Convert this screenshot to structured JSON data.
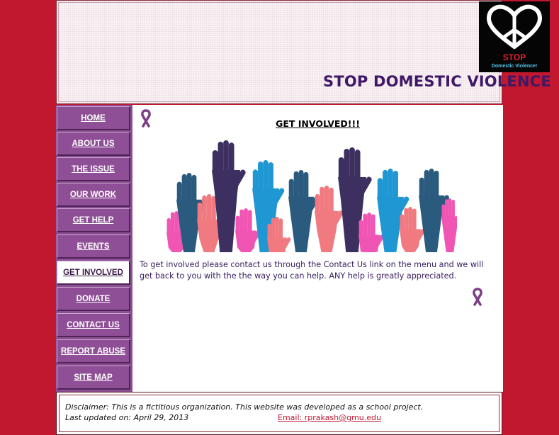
{
  "header": {
    "title": "STOP DOMESTIC VIOLENCE",
    "logo": {
      "icon": "heart-peace-symbol",
      "stop_text": "STOP",
      "sub_text": "Domestic Violence!"
    }
  },
  "nav": {
    "items": [
      {
        "label": "HOME",
        "active": false
      },
      {
        "label": "ABOUT US",
        "active": false
      },
      {
        "label": "THE ISSUE",
        "active": false
      },
      {
        "label": "OUR WORK",
        "active": false
      },
      {
        "label": "GET HELP",
        "active": false
      },
      {
        "label": "EVENTS",
        "active": false
      },
      {
        "label": "GET INVOLVED",
        "active": true
      },
      {
        "label": "DONATE",
        "active": false
      },
      {
        "label": "CONTACT US",
        "active": false
      },
      {
        "label": "REPORT ABUSE",
        "active": false
      },
      {
        "label": "SITE MAP",
        "active": false
      }
    ]
  },
  "main": {
    "heading": "GET INVOLVED!!!",
    "body": "To get involved please contact us through the Contact Us link on the menu and we will get back to you with the the way you can help. ANY help is greatly appreciated.",
    "image_icon": "raised-hands-illustration",
    "ribbon_icon": "purple-awareness-ribbon"
  },
  "footer": {
    "disclaimer": "Disclaimer: This is a fictitious organization. This website was developed as a school project.",
    "updated_label": "Last updated on:",
    "updated_date": "April 29, 2013",
    "email_label": "Email: rprakash@gmu.edu"
  },
  "colors": {
    "page_background": "#c1172f",
    "nav_background": "#8f4f96",
    "title_color": "#3f1866",
    "hand_navy": "#2a5a7e",
    "hand_purple": "#3d2f5f",
    "hand_pink": "#f055b4",
    "hand_salmon": "#f07a80",
    "hand_blue": "#1f97d3"
  }
}
